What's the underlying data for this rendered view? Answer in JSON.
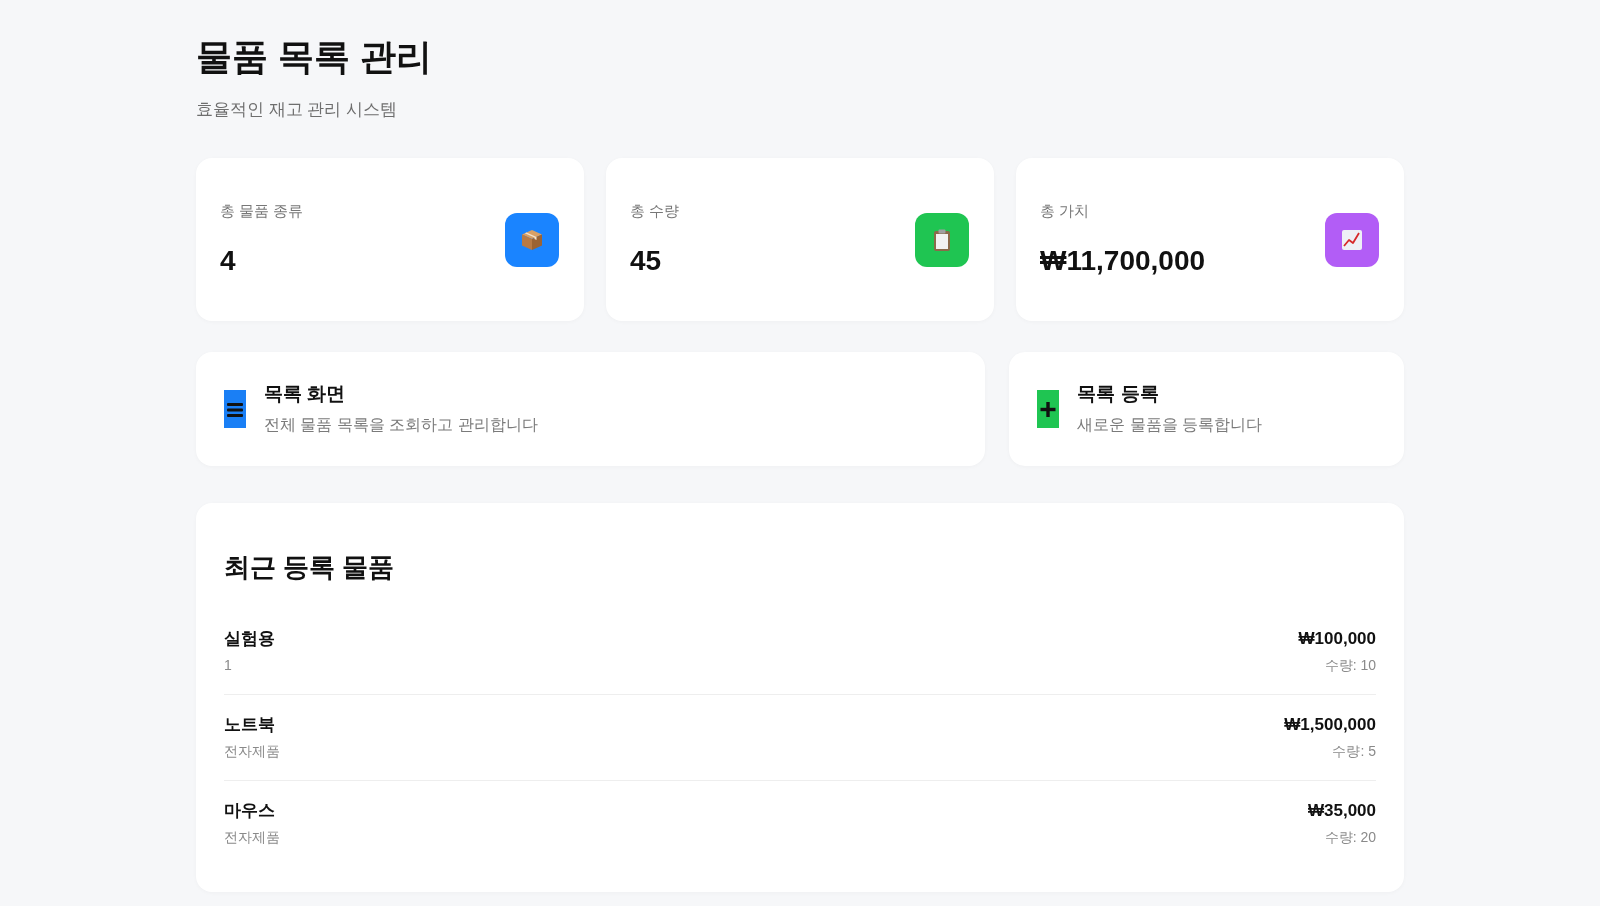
{
  "header": {
    "title": "물품 목록 관리",
    "subtitle": "효율적인 재고 관리 시스템"
  },
  "stats": [
    {
      "label": "총 물품 종류",
      "value": "4",
      "color": "#1a84ff"
    },
    {
      "label": "총 수량",
      "value": "45",
      "color": "#1fc552"
    },
    {
      "label": "총 가치",
      "value": "₩11,700,000",
      "color": "#b25df6"
    }
  ],
  "nav_cards": [
    {
      "title": "목록 화면",
      "description": "전체 물품 목록을 조회하고 관리합니다",
      "color": "#1a7ff5"
    },
    {
      "title": "목록 등록",
      "description": "새로운 물품을 등록합니다",
      "color": "#1fc552"
    }
  ],
  "recent": {
    "title": "최근 등록 물품",
    "items": [
      {
        "name": "실험용",
        "category": "1",
        "price": "₩100,000",
        "quantity": "수량: 10"
      },
      {
        "name": "노트북",
        "category": "전자제품",
        "price": "₩1,500,000",
        "quantity": "수량: 5"
      },
      {
        "name": "마우스",
        "category": "전자제품",
        "price": "₩35,000",
        "quantity": "수량: 20"
      }
    ]
  }
}
